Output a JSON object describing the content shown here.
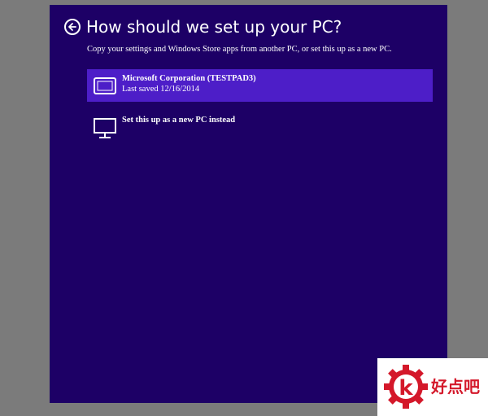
{
  "header": {
    "title": "How should we set up your PC?",
    "subtitle": "Copy your settings and Windows Store apps from another PC, or set this up as a new PC."
  },
  "options": [
    {
      "title": "Microsoft Corporation (TESTPAD3)",
      "subtitle": "Last saved 12/16/2014",
      "icon": "tablet-icon",
      "selected": true
    },
    {
      "title": "Set this up as a new PC instead",
      "icon": "monitor-icon",
      "selected": false
    }
  ],
  "watermark": {
    "text": "好点吧",
    "logo_letter": "k"
  },
  "colors": {
    "page_background": "#7b7b7b",
    "panel_background": "#1d0066",
    "selected_option": "#4d1ec8",
    "text": "#ffffff",
    "watermark_red": "#d4182a"
  }
}
